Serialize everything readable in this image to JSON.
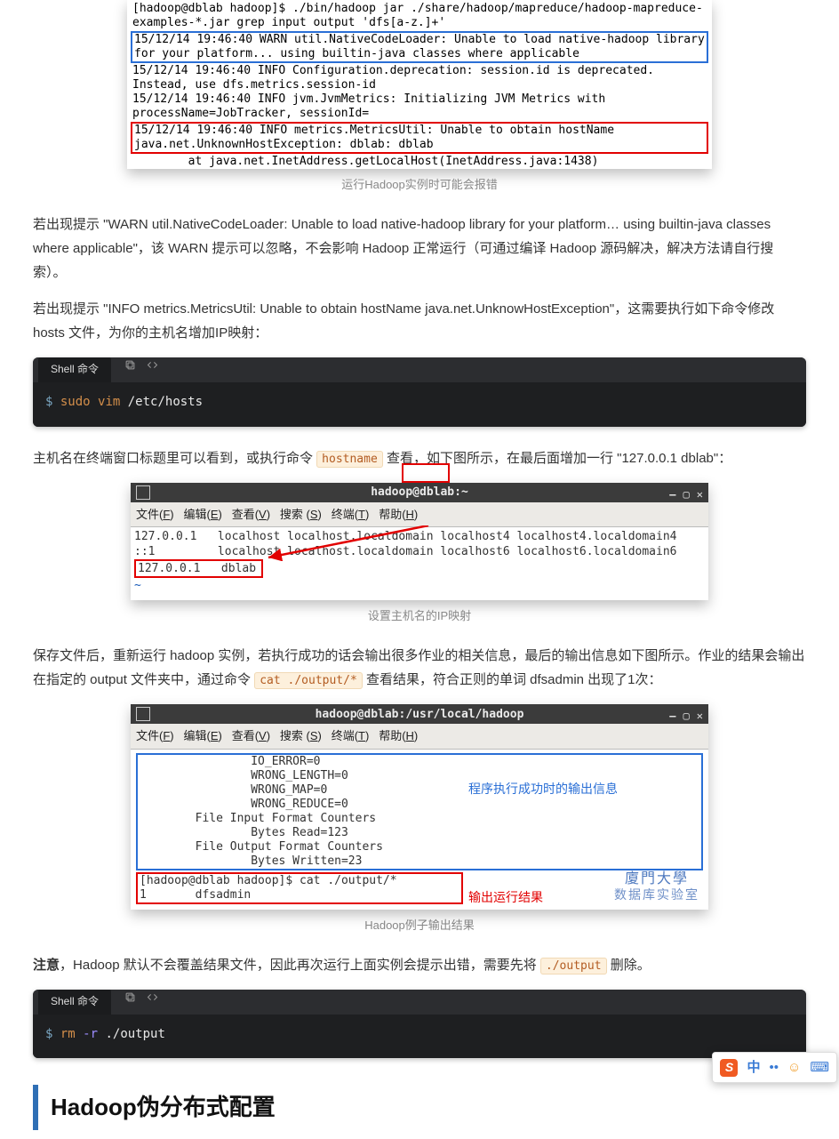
{
  "warnShot": {
    "cmd": "[hadoop@dblab hadoop]$ ./bin/hadoop jar ./share/hadoop/mapreduce/hadoop-mapreduce-examples-*.jar grep input output 'dfs[a-z.]+'",
    "warn": "15/12/14 19:46:40 WARN util.NativeCodeLoader: Unable to load native-hadoop library for your platform... using builtin-java classes where applicable",
    "mid1": "15/12/14 19:46:40 INFO Configuration.deprecation: session.id is deprecated. Instead, use dfs.metrics.session-id",
    "mid2": "15/12/14 19:46:40 INFO jvm.JvmMetrics: Initializing JVM Metrics with processName=JobTracker, sessionId=",
    "err": "15/12/14 19:46:40 INFO metrics.MetricsUtil: Unable to obtain hostName\njava.net.UnknownHostException: dblab: dblab",
    "tail": "        at java.net.InetAddress.getLocalHost(InetAddress.java:1438)",
    "caption": "运行Hadoop实例时可能会报错"
  },
  "para1": "若出现提示 \"WARN util.NativeCodeLoader: Unable to load native-hadoop library for your platform… using builtin-java classes where applicable\"，该 WARN 提示可以忽略，不会影响 Hadoop 正常运行（可通过编译 Hadoop 源码解决，解决方法请自行搜索）。",
  "para2": "若出现提示 \"INFO metrics.MetricsUtil: Unable to obtain hostName java.net.UnknowHostException\"，这需要执行如下命令修改 hosts 文件，为你的主机名增加IP映射：",
  "code1": {
    "tab": "Shell 命令",
    "prompt": "$",
    "kw": "sudo vim",
    "rest": " /etc/hosts"
  },
  "para3a": "主机名在终端窗口标题里可以看到，或执行命令 ",
  "para3code": "hostname",
  "para3b": " 查看，如下图所示，在最后面增加一行 \"127.0.0.1 dblab\"：",
  "hostsShot": {
    "title_user": "hadoop@",
    "title_host": "dblab:",
    "title_tail": "~",
    "menu": {
      "file": "文件(F)",
      "edit": "编辑(E)",
      "view": "查看(V)",
      "search": "搜索 (S)",
      "term": "终端(T)",
      "help": "帮助(H)"
    },
    "row1": "127.0.0.1   localhost localhost.localdomain localhost4 localhost4.localdomain4",
    "row2": "::1         localhost localhost.localdomain localhost6 localhost6.localdomain6",
    "row3": "127.0.0.1   dblab",
    "caption": "设置主机名的IP映射"
  },
  "para4a": "保存文件后，重新运行 hadoop 实例，若执行成功的话会输出很多作业的相关信息，最后的输出信息如下图所示。作业的结果会输出在指定的 output 文件夹中，通过命令 ",
  "para4code": "cat ./output/*",
  "para4b": " 查看结果，符合正则的单词 dfsadmin 出现了1次：",
  "outShot": {
    "title": "hadoop@dblab:/usr/local/hadoop",
    "menu": {
      "file": "文件(F)",
      "edit": "编辑(E)",
      "view": "查看(V)",
      "search": "搜索 (S)",
      "term": "终端(T)",
      "help": "帮助(H)"
    },
    "blue": "                IO_ERROR=0\n                WRONG_LENGTH=0\n                WRONG_MAP=0\n                WRONG_REDUCE=0\n        File Input Format Counters\n                Bytes Read=123\n        File Output Format Counters\n                Bytes Written=23",
    "red": "[hadoop@dblab hadoop]$ cat ./output/*\n1       dfsadmin",
    "annot_blue": "程序执行成功时的输出信息",
    "annot_red": "输出运行结果",
    "watermark1": "廈門大學",
    "watermark2": "数据库实验室",
    "caption": "Hadoop例子输出结果"
  },
  "para5a": "注意",
  "para5b": "，Hadoop 默认不会覆盖结果文件，因此再次运行上面实例会提示出错，需要先将 ",
  "para5code": "./output",
  "para5c": " 删除。",
  "code2": {
    "tab": "Shell 命令",
    "prompt": "$",
    "kw": "rm",
    "flag": "-r",
    "rest": " ./output"
  },
  "heading": "Hadoop伪分布式配置",
  "ime": {
    "zhong": "中",
    "dot": "•"
  }
}
